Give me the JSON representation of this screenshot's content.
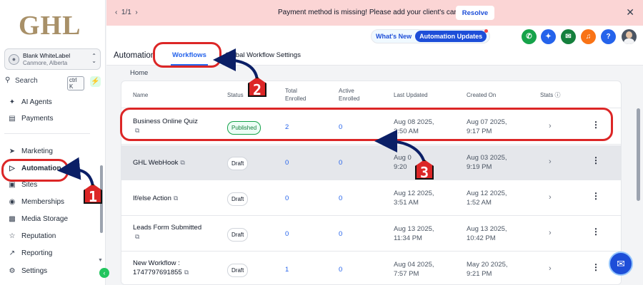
{
  "sidebar": {
    "logo": "GHL",
    "account": {
      "name": "Blank WhiteLabel",
      "location": "Canmore, Alberta"
    },
    "search": {
      "label": "Search",
      "shortcut": "ctrl K"
    },
    "items": [
      {
        "label": "AI Agents",
        "icon": "sparkle-icon"
      },
      {
        "label": "Payments",
        "icon": "receipt-icon"
      },
      {
        "label": "Marketing",
        "icon": "send-icon"
      },
      {
        "label": "Automation",
        "icon": "automation-icon",
        "active": true
      },
      {
        "label": "Sites",
        "icon": "globe-icon"
      },
      {
        "label": "Memberships",
        "icon": "memberships-icon"
      },
      {
        "label": "Media Storage",
        "icon": "media-icon"
      },
      {
        "label": "Reputation",
        "icon": "star-icon"
      },
      {
        "label": "Reporting",
        "icon": "chart-icon"
      },
      {
        "label": "Settings",
        "icon": "gear-icon"
      }
    ]
  },
  "banner": {
    "pagination": "1/1",
    "message": "Payment method is missing! Please add your client's card.",
    "resolve_label": "Resolve"
  },
  "header": {
    "whats_new": "What's New",
    "updates_chip": "Automation Updates",
    "icons": [
      "phone-icon",
      "magic-icon",
      "megaphone-icon",
      "bell-icon",
      "help-icon",
      "avatar"
    ],
    "icon_colors": [
      "#16a34a",
      "#2563eb",
      "#15803d",
      "#f97316",
      "#2563eb"
    ]
  },
  "page": {
    "title": "Automation",
    "tabs": [
      "Workflows",
      "Global Workflow Settings"
    ],
    "breadcrumb": "Home"
  },
  "table": {
    "columns": [
      "Name",
      "Status",
      "Total Enrolled",
      "Active Enrolled",
      "Last Updated",
      "Created On",
      "Stats"
    ],
    "rows": [
      {
        "name1": "Business Online Quiz",
        "name2": "",
        "status": "Published",
        "total": "2",
        "active": "0",
        "upd1": "Aug 08 2025,",
        "upd2": "2:50 AM",
        "cre1": "Aug 07 2025,",
        "cre2": "9:17 PM"
      },
      {
        "name1": "GHL WebHook",
        "name2": "",
        "status": "Draft",
        "total": "0",
        "active": "0",
        "upd1": "Aug 0",
        "upd2": "9:20",
        "cre1": "Aug 03 2025,",
        "cre2": "9:19 PM"
      },
      {
        "name1": "If/else Action",
        "name2": "",
        "status": "Draft",
        "total": "0",
        "active": "0",
        "upd1": "Aug 12 2025,",
        "upd2": "3:51 AM",
        "cre1": "Aug 12 2025,",
        "cre2": "1:52 AM"
      },
      {
        "name1": "Leads Form Submitted",
        "name2": "",
        "status": "Draft",
        "total": "0",
        "active": "0",
        "upd1": "Aug 13 2025,",
        "upd2": "11:34 PM",
        "cre1": "Aug 13 2025,",
        "cre2": "10:42 PM"
      },
      {
        "name1": "New Workflow :",
        "name2": "1747797691855",
        "status": "Draft",
        "total": "1",
        "active": "0",
        "upd1": "Aug 04 2025,",
        "upd2": "7:57 PM",
        "cre1": "May 20 2025,",
        "cre2": "9:21 PM"
      }
    ]
  },
  "annotations": {
    "step1": "1",
    "step2": "2",
    "step3": "3",
    "color": "#dc2626",
    "arrow_color": "#0b1f66"
  }
}
